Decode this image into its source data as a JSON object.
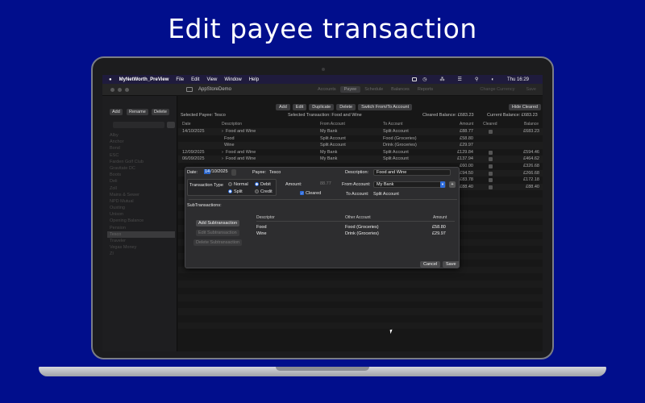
{
  "headline": "Edit payee transaction",
  "menubar": {
    "app_name": "MyNetWorth_PreView",
    "items": [
      "File",
      "Edit",
      "View",
      "Window",
      "Help"
    ],
    "clock": "Thu 16:29"
  },
  "toolbar": {
    "window_title": "AppStoreDemo",
    "tabs": [
      "Accounts",
      "Payee",
      "Schedule",
      "Balances",
      "Reports"
    ],
    "active_tab": "Payee",
    "right_items": [
      "Change Currency",
      "Save"
    ]
  },
  "sidebar": {
    "add_label": "Add",
    "rename_label": "Rename",
    "delete_label": "Delete",
    "payees": [
      "Alby",
      "Anchor",
      "Bond",
      "ESC",
      "Farden Golf Club",
      "Gravitate DC",
      "Boots",
      "Deli",
      "Zoll",
      "Mains & Sewer",
      "NPD Mutual",
      "Ousting",
      "Unison",
      "Opening Balance",
      "Pension",
      "Tesco",
      "Traveler",
      "Vegas Money",
      "ZI"
    ],
    "selected_payee": "Tesco"
  },
  "actions": {
    "buttons": [
      "Add",
      "Edit",
      "Duplicate",
      "Delete",
      "Switch From/To Account"
    ],
    "hide_cleared": "Hide Cleared"
  },
  "summary": {
    "selected_payee": "Selected Payee:  Tesco",
    "selected_transaction": "Selected Transaction:  Food and Wine",
    "cleared_balance": "Cleared Balance:  £683.23",
    "current_balance": "Current Balance:  £683.23"
  },
  "table": {
    "headers": [
      "Date",
      "Description",
      "From Account",
      "To Account",
      "Amount",
      "Cleared",
      "Balance"
    ],
    "rows": [
      {
        "date": "14/10/2025",
        "desc": "Food and Wine",
        "from": "My Bank",
        "to": "Split Account",
        "amount": "£88.77",
        "balance": "£683.23",
        "indent": false,
        "expand": true,
        "cleared": true
      },
      {
        "date": "",
        "desc": "Food",
        "from": "Split Account",
        "to": "Food (Groceries)",
        "amount": "£58.80",
        "balance": "",
        "indent": true,
        "expand": false,
        "cleared": false
      },
      {
        "date": "",
        "desc": "Wine",
        "from": "Split Account",
        "to": "Drink (Groceries)",
        "amount": "£29.97",
        "balance": "",
        "indent": true,
        "expand": false,
        "cleared": false
      },
      {
        "date": "12/09/2025",
        "desc": "Food and Wine",
        "from": "My Bank",
        "to": "Split Account",
        "amount": "£129.84",
        "balance": "£594.46",
        "indent": false,
        "expand": true,
        "cleared": true
      },
      {
        "date": "06/09/2025",
        "desc": "Food and Wine",
        "from": "My Bank",
        "to": "Split Account",
        "amount": "£137.94",
        "balance": "£464.62",
        "indent": false,
        "expand": true,
        "cleared": true
      },
      {
        "date": "",
        "desc": "",
        "from": "",
        "to": "",
        "amount": "£60.00",
        "balance": "£326.68",
        "indent": false,
        "expand": false,
        "cleared": true
      },
      {
        "date": "",
        "desc": "",
        "from": "",
        "to": "",
        "amount": "£94.50",
        "balance": "£266.68",
        "indent": false,
        "expand": false,
        "cleared": true
      },
      {
        "date": "",
        "desc": "",
        "from": "",
        "to": "",
        "amount": "£83.78",
        "balance": "£172.18",
        "indent": false,
        "expand": false,
        "cleared": true
      },
      {
        "date": "",
        "desc": "",
        "from": "",
        "to": "",
        "amount": "£88.40",
        "balance": "£88.40",
        "indent": false,
        "expand": false,
        "cleared": true
      }
    ]
  },
  "dialog": {
    "date_label": "Date:",
    "date_day": "14",
    "date_rest": "/10/2025",
    "payee_label": "Payee:",
    "payee_value": "Tesco",
    "description_label": "Description:",
    "description_value": "Food and Wine",
    "transaction_type_label": "Transaction Type",
    "type_options": [
      "Normal",
      "Split"
    ],
    "type_selected": "Split",
    "direction_options": [
      "Debit",
      "Credit"
    ],
    "direction_selected": "Debit",
    "amount_label": "Amount:",
    "amount_value": "88.77",
    "from_account_label": "From Account:",
    "from_account_value": "My Bank",
    "cleared_label": "Cleared",
    "cleared_checked": true,
    "to_account_label": "To Account:",
    "to_account_value": "Split Account",
    "subtransactions_label": "SubTransactions:",
    "add_sub": "Add Subtransaction",
    "edit_sub": "Edit Subtransaction",
    "delete_sub": "Delete Subtransaction",
    "sub_headers": [
      "Descriptor",
      "Other Account",
      "Amount"
    ],
    "sub_rows": [
      {
        "desc": "Food",
        "account": "Food (Groceries)",
        "amount": "£58.80"
      },
      {
        "desc": "Wine",
        "account": "Drink (Groceries)",
        "amount": "£29.97"
      }
    ],
    "cancel_label": "Cancel",
    "save_label": "Save"
  },
  "colors": {
    "background": "#010e8c",
    "accent": "#2e6cdc"
  }
}
